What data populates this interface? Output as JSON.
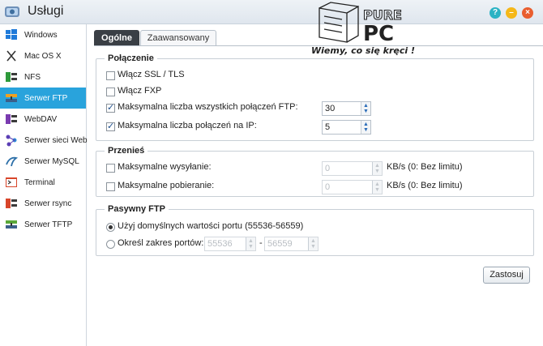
{
  "app": {
    "title": "Usługi"
  },
  "watermark": {
    "brand_top": "PURE",
    "brand_bottom": "PC",
    "tagline": "Wiemy, co się kręci !"
  },
  "sidebar": {
    "items": [
      {
        "label": "Windows",
        "icon": "windows-icon"
      },
      {
        "label": "Mac OS X",
        "icon": "mac-x-icon"
      },
      {
        "label": "NFS",
        "icon": "nfs-icon"
      },
      {
        "label": "Serwer FTP",
        "icon": "ftp-server-icon",
        "active": true
      },
      {
        "label": "WebDAV",
        "icon": "webdav-icon"
      },
      {
        "label": "Serwer sieci Web",
        "icon": "web-server-icon"
      },
      {
        "label": "Serwer MySQL",
        "icon": "mysql-icon"
      },
      {
        "label": "Terminal",
        "icon": "terminal-icon"
      },
      {
        "label": "Serwer rsync",
        "icon": "rsync-icon"
      },
      {
        "label": "Serwer TFTP",
        "icon": "tftp-icon"
      }
    ]
  },
  "tabs": [
    {
      "label": "Ogólne",
      "active": true
    },
    {
      "label": "Zaawansowany",
      "active": false
    }
  ],
  "connection": {
    "legend": "Połączenie",
    "ssl_label": "Włącz SSL / TLS",
    "ssl_checked": false,
    "fxp_label": "Włącz FXP",
    "fxp_checked": false,
    "max_all_label": "Maksymalna liczba wszystkich połączeń FTP:",
    "max_all_checked": true,
    "max_all_value": "30",
    "max_ip_label": "Maksymalna liczba połączeń na IP:",
    "max_ip_checked": true,
    "max_ip_value": "5"
  },
  "transfer": {
    "legend": "Przenieś",
    "upload_label": "Maksymalne wysyłanie:",
    "upload_value": "0",
    "upload_unit": "KB/s (0: Bez limitu)",
    "download_label": "Maksymalne pobieranie:",
    "download_value": "0",
    "download_unit": "KB/s (0: Bez limitu)"
  },
  "passive": {
    "legend": "Pasywny FTP",
    "default_label": "Użyj domyślnych wartości portu (55536-56559)",
    "default_selected": true,
    "range_label": "Określ zakres portów:",
    "range_from": "55536",
    "range_sep": "-",
    "range_to": "56559"
  },
  "actions": {
    "apply_label": "Zastosuj"
  },
  "colors": {
    "accent": "#29a3dc",
    "active_tab": "#3a3f45"
  }
}
